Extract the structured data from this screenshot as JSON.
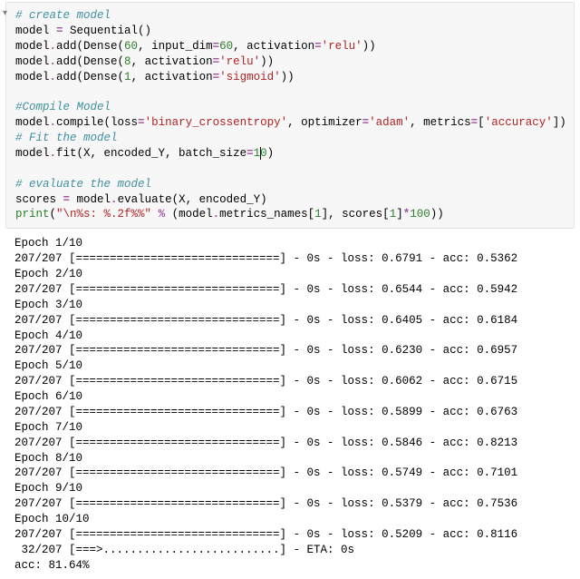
{
  "code": {
    "c1": "# create model",
    "l2_a": "model ",
    "l2_b": "=",
    "l2_c": " Sequential()",
    "l3_a": "model",
    "l3_b": ".",
    "l3_c": "add(Dense(",
    "l3_d": "60",
    "l3_e": ", input_dim",
    "l3_f": "=",
    "l3_g": "60",
    "l3_h": ", activation",
    "l3_i": "=",
    "l3_j": "'relu'",
    "l3_k": "))",
    "l4_a": "model",
    "l4_b": ".",
    "l4_c": "add(Dense(",
    "l4_d": "8",
    "l4_e": ", activation",
    "l4_f": "=",
    "l4_g": "'relu'",
    "l4_h": "))",
    "l5_a": "model",
    "l5_b": ".",
    "l5_c": "add(Dense(",
    "l5_d": "1",
    "l5_e": ", activation",
    "l5_f": "=",
    "l5_g": "'sigmoid'",
    "l5_h": "))",
    "blank": " ",
    "c2": "#Compile Model",
    "l8_a": "model",
    "l8_b": ".",
    "l8_c": "compile(loss",
    "l8_d": "=",
    "l8_e": "'binary_crossentropy'",
    "l8_f": ", optimizer",
    "l8_g": "=",
    "l8_h": "'adam'",
    "l8_i": ", metrics",
    "l8_j": "=",
    "l8_k": "[",
    "l8_l": "'accuracy'",
    "l8_m": "])",
    "c3": "# Fit the model",
    "l10_a": "model",
    "l10_b": ".",
    "l10_c": "fit(X, encoded_Y, batch_size",
    "l10_d": "=",
    "l10_e": "1",
    "l10_f": "0",
    "l10_g": ")",
    "c4": "# evaluate the model",
    "l13_a": "scores ",
    "l13_b": "=",
    "l13_c": " model",
    "l13_d": ".",
    "l13_e": "evaluate(X, encoded_Y)",
    "l14_a": "print",
    "l14_b": "(",
    "l14_c": "\"\\n%s: %.2f%%\"",
    "l14_d": " ",
    "l14_e": "%",
    "l14_f": " (model",
    "l14_g": ".",
    "l14_h": "metrics_names[",
    "l14_i": "1",
    "l14_j": "], scores[",
    "l14_k": "1",
    "l14_l": "]",
    "l14_m": "*",
    "l14_n": "100",
    "l14_o": "))"
  },
  "output": {
    "lines": [
      "Epoch 1/10",
      "207/207 [==============================] - 0s - loss: 0.6791 - acc: 0.5362",
      "Epoch 2/10",
      "207/207 [==============================] - 0s - loss: 0.6544 - acc: 0.5942",
      "Epoch 3/10",
      "207/207 [==============================] - 0s - loss: 0.6405 - acc: 0.6184",
      "Epoch 4/10",
      "207/207 [==============================] - 0s - loss: 0.6230 - acc: 0.6957",
      "Epoch 5/10",
      "207/207 [==============================] - 0s - loss: 0.6062 - acc: 0.6715",
      "Epoch 6/10",
      "207/207 [==============================] - 0s - loss: 0.5899 - acc: 0.6763",
      "Epoch 7/10",
      "207/207 [==============================] - 0s - loss: 0.5846 - acc: 0.8213",
      "Epoch 8/10",
      "207/207 [==============================] - 0s - loss: 0.5749 - acc: 0.7101",
      "Epoch 9/10",
      "207/207 [==============================] - 0s - loss: 0.5379 - acc: 0.7536",
      "Epoch 10/10",
      "207/207 [==============================] - 0s - loss: 0.5209 - acc: 0.8116",
      " 32/207 [===>..........................] - ETA: 0s",
      "acc: 81.64%"
    ]
  }
}
